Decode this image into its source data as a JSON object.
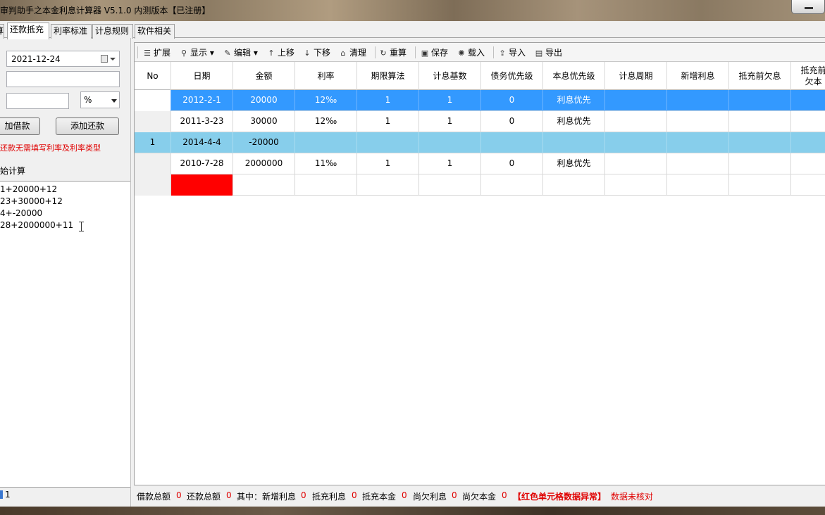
{
  "window": {
    "title": "审判助手之本金利息计算器 V5.1.0 内测版本【已注册】"
  },
  "tabs": [
    {
      "label": "算"
    },
    {
      "label": "还款抵充"
    },
    {
      "label": "利率标准"
    },
    {
      "label": "计息规则"
    },
    {
      "label": "软件相关"
    }
  ],
  "left": {
    "date_value": "2021-12-24",
    "unit_value": "%",
    "add_loan_label": "加借款",
    "add_repay_label": "添加还款",
    "notice": "还款无需填写利率及利率类型",
    "section_label": "始计算",
    "formula_lines": [
      "1+20000+12",
      "23+30000+12",
      "4+-20000",
      "28+2000000+11"
    ],
    "footer_number": "1"
  },
  "toolbar": {
    "expand": "扩展",
    "display": "显示",
    "edit": "编辑",
    "move_up": "上移",
    "move_down": "下移",
    "clear": "清理",
    "recalc": "重算",
    "save": "保存",
    "load": "载入",
    "import": "导入",
    "export": "导出"
  },
  "table": {
    "headers": [
      "No",
      "日期",
      "金额",
      "利率",
      "期限算法",
      "计息基数",
      "债务优先级",
      "本息优先级",
      "计息周期",
      "新增利息",
      "抵充前欠息",
      "抵充前欠本"
    ],
    "rows": [
      {
        "no": "",
        "date": "2012-2-1",
        "amount": "20000",
        "rate": "12‰",
        "term": "1",
        "base": "1",
        "debt_pri": "0",
        "pi_pri": "利息优先",
        "period": "",
        "new_int": "",
        "pre_int": "",
        "pre_pri": ""
      },
      {
        "no": "",
        "date": "2011-3-23",
        "amount": "30000",
        "rate": "12‰",
        "term": "1",
        "base": "1",
        "debt_pri": "0",
        "pi_pri": "利息优先",
        "period": "",
        "new_int": "",
        "pre_int": "",
        "pre_pri": ""
      },
      {
        "no": "1",
        "date": "2014-4-4",
        "amount": "-20000",
        "rate": "",
        "term": "",
        "base": "",
        "debt_pri": "",
        "pi_pri": "",
        "period": "",
        "new_int": "",
        "pre_int": "",
        "pre_pri": ""
      },
      {
        "no": "",
        "date": "2010-7-28",
        "amount": "2000000",
        "rate": "11‰",
        "term": "1",
        "base": "1",
        "debt_pri": "0",
        "pi_pri": "利息优先",
        "period": "",
        "new_int": "",
        "pre_int": "",
        "pre_pri": ""
      }
    ]
  },
  "status": {
    "loan_total_label": "借款总额",
    "loan_total": "0",
    "repay_total_label": "还款总额",
    "repay_total": "0",
    "of_which_label": "其中：新增利息",
    "new_interest": "0",
    "offset_interest_label": "抵充利息",
    "offset_interest": "0",
    "offset_principal_label": "抵充本金",
    "offset_principal": "0",
    "owed_interest_label": "尚欠利息",
    "owed_interest": "0",
    "owed_principal_label": "尚欠本金",
    "owed_principal": "0",
    "warning": "【红色单元格数据异常】",
    "unverified": "数据未核对"
  },
  "colors": {
    "selected_row": "#3399ff",
    "highlight_row": "#87ceeb",
    "error_cell": "#ff0000",
    "warning_text": "#e00000"
  }
}
